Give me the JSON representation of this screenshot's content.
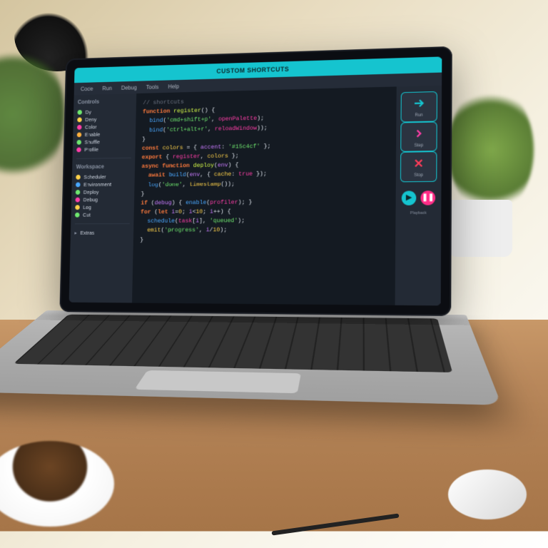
{
  "scene": "laptop on wooden desk with coffee, plants, lamp, mouse, pen",
  "app": {
    "title": "CUSTOM SHORTCUTS"
  },
  "menubar": [
    "Code",
    "Run",
    "Debug",
    "Tools",
    "Help"
  ],
  "sidebar": {
    "section1_title": "Controls",
    "section1": [
      {
        "label": "Dy",
        "color": "#6fe86f"
      },
      {
        "label": "Deny",
        "color": "#ffd24a"
      },
      {
        "label": "Color",
        "color": "#ff3ea8"
      },
      {
        "label": "Enable",
        "color": "#ffb03d"
      },
      {
        "label": "Shuffle",
        "color": "#6fe86f"
      },
      {
        "label": "Profile",
        "color": "#ff3ea8"
      }
    ],
    "section2_title": "Workspace",
    "section2": [
      {
        "label": "Scheduler",
        "color": "#ffd24a"
      },
      {
        "label": "Environment",
        "color": "#4aa8ff"
      },
      {
        "label": "Deploy",
        "color": "#6fe86f"
      },
      {
        "label": "Debug",
        "color": "#ff3ea8"
      },
      {
        "label": "Log",
        "color": "#ffd24a"
      },
      {
        "label": "Cut",
        "color": "#6fe86f"
      }
    ],
    "footer": "Extras"
  },
  "code": [
    [
      {
        "c": "tk-c",
        "t": "// shortcuts"
      }
    ],
    [
      {
        "c": "tk-k",
        "t": "function "
      },
      {
        "c": "tk-f",
        "t": "register"
      },
      {
        "c": "tk-d",
        "t": "() {"
      }
    ],
    [
      {
        "c": "tk-d",
        "t": "  "
      },
      {
        "c": "tk-b",
        "t": "bind"
      },
      {
        "c": "tk-d",
        "t": "("
      },
      {
        "c": "tk-s",
        "t": "'cmd+shift+p'"
      },
      {
        "c": "tk-d",
        "t": ", "
      },
      {
        "c": "tk-p",
        "t": "openPalette"
      },
      {
        "c": "tk-d",
        "t": ");"
      }
    ],
    [
      {
        "c": "tk-d",
        "t": "  "
      },
      {
        "c": "tk-b",
        "t": "bind"
      },
      {
        "c": "tk-d",
        "t": "("
      },
      {
        "c": "tk-s",
        "t": "'ctrl+alt+r'"
      },
      {
        "c": "tk-d",
        "t": ", "
      },
      {
        "c": "tk-p",
        "t": "reloadWindow"
      },
      {
        "c": "tk-d",
        "t": "));"
      }
    ],
    [
      {
        "c": "tk-d",
        "t": "}"
      }
    ],
    [
      {
        "c": "tk-k",
        "t": "const "
      },
      {
        "c": "tk-y",
        "t": "colors"
      },
      {
        "c": "tk-d",
        "t": " = { "
      },
      {
        "c": "tk-v",
        "t": "accent"
      },
      {
        "c": "tk-d",
        "t": ": "
      },
      {
        "c": "tk-s",
        "t": "'#15c4cf'"
      },
      {
        "c": "tk-d",
        "t": " };"
      }
    ],
    [
      {
        "c": "tk-k",
        "t": "export "
      },
      {
        "c": "tk-d",
        "t": "{ "
      },
      {
        "c": "tk-p",
        "t": "register"
      },
      {
        "c": "tk-d",
        "t": ", "
      },
      {
        "c": "tk-y",
        "t": "colors"
      },
      {
        "c": "tk-d",
        "t": " };"
      }
    ],
    [
      {
        "c": "tk-d",
        "t": ""
      }
    ],
    [
      {
        "c": "tk-k",
        "t": "async function "
      },
      {
        "c": "tk-f",
        "t": "deploy"
      },
      {
        "c": "tk-d",
        "t": "("
      },
      {
        "c": "tk-v",
        "t": "env"
      },
      {
        "c": "tk-d",
        "t": ") {"
      }
    ],
    [
      {
        "c": "tk-d",
        "t": "  "
      },
      {
        "c": "tk-k",
        "t": "await "
      },
      {
        "c": "tk-b",
        "t": "build"
      },
      {
        "c": "tk-d",
        "t": "("
      },
      {
        "c": "tk-v",
        "t": "env"
      },
      {
        "c": "tk-d",
        "t": ", { "
      },
      {
        "c": "tk-y",
        "t": "cache"
      },
      {
        "c": "tk-d",
        "t": ": "
      },
      {
        "c": "tk-p",
        "t": "true"
      },
      {
        "c": "tk-d",
        "t": " });"
      }
    ],
    [
      {
        "c": "tk-d",
        "t": "  "
      },
      {
        "c": "tk-b",
        "t": "log"
      },
      {
        "c": "tk-d",
        "t": "("
      },
      {
        "c": "tk-s",
        "t": "'done'"
      },
      {
        "c": "tk-d",
        "t": ", "
      },
      {
        "c": "tk-y",
        "t": "timestamp"
      },
      {
        "c": "tk-d",
        "t": "());"
      }
    ],
    [
      {
        "c": "tk-d",
        "t": "}"
      }
    ],
    [
      {
        "c": "tk-d",
        "t": ""
      }
    ],
    [
      {
        "c": "tk-k",
        "t": "if"
      },
      {
        "c": "tk-d",
        "t": " ("
      },
      {
        "c": "tk-v",
        "t": "debug"
      },
      {
        "c": "tk-d",
        "t": ") { "
      },
      {
        "c": "tk-b",
        "t": "enable"
      },
      {
        "c": "tk-d",
        "t": "("
      },
      {
        "c": "tk-p",
        "t": "profiler"
      },
      {
        "c": "tk-d",
        "t": "); }"
      }
    ],
    [
      {
        "c": "tk-k",
        "t": "for"
      },
      {
        "c": "tk-d",
        "t": " ("
      },
      {
        "c": "tk-k",
        "t": "let "
      },
      {
        "c": "tk-v",
        "t": "i"
      },
      {
        "c": "tk-d",
        "t": "="
      },
      {
        "c": "tk-y",
        "t": "0"
      },
      {
        "c": "tk-d",
        "t": "; "
      },
      {
        "c": "tk-v",
        "t": "i"
      },
      {
        "c": "tk-d",
        "t": "<"
      },
      {
        "c": "tk-y",
        "t": "10"
      },
      {
        "c": "tk-d",
        "t": "; "
      },
      {
        "c": "tk-v",
        "t": "i"
      },
      {
        "c": "tk-d",
        "t": "++) {"
      }
    ],
    [
      {
        "c": "tk-d",
        "t": "  "
      },
      {
        "c": "tk-b",
        "t": "schedule"
      },
      {
        "c": "tk-d",
        "t": "("
      },
      {
        "c": "tk-p",
        "t": "task"
      },
      {
        "c": "tk-d",
        "t": "["
      },
      {
        "c": "tk-v",
        "t": "i"
      },
      {
        "c": "tk-d",
        "t": "], "
      },
      {
        "c": "tk-s",
        "t": "'queued'"
      },
      {
        "c": "tk-d",
        "t": ");"
      }
    ],
    [
      {
        "c": "tk-d",
        "t": "  "
      },
      {
        "c": "tk-y",
        "t": "emit"
      },
      {
        "c": "tk-d",
        "t": "("
      },
      {
        "c": "tk-s",
        "t": "'progress'"
      },
      {
        "c": "tk-d",
        "t": ", "
      },
      {
        "c": "tk-v",
        "t": "i"
      },
      {
        "c": "tk-d",
        "t": "/"
      },
      {
        "c": "tk-y",
        "t": "10"
      },
      {
        "c": "tk-d",
        "t": ");"
      }
    ],
    [
      {
        "c": "tk-d",
        "t": "}"
      }
    ]
  ],
  "tools": [
    {
      "name": "run",
      "label": "Run",
      "icon": "arrow",
      "color": "#15c4cf"
    },
    {
      "name": "step",
      "label": "Step",
      "icon": "chev",
      "color": "#ff3ea8"
    },
    {
      "name": "stop",
      "label": "Stop",
      "icon": "x",
      "color": "#ff3d5a"
    }
  ],
  "rightbar": {
    "play_glyph": "▶",
    "pause_glyph": "❚❚",
    "caption": "Playback"
  },
  "colors": {
    "accent": "#15c4cf",
    "bg": "#1e2530",
    "panel": "#232a35",
    "editor": "#141a22"
  }
}
